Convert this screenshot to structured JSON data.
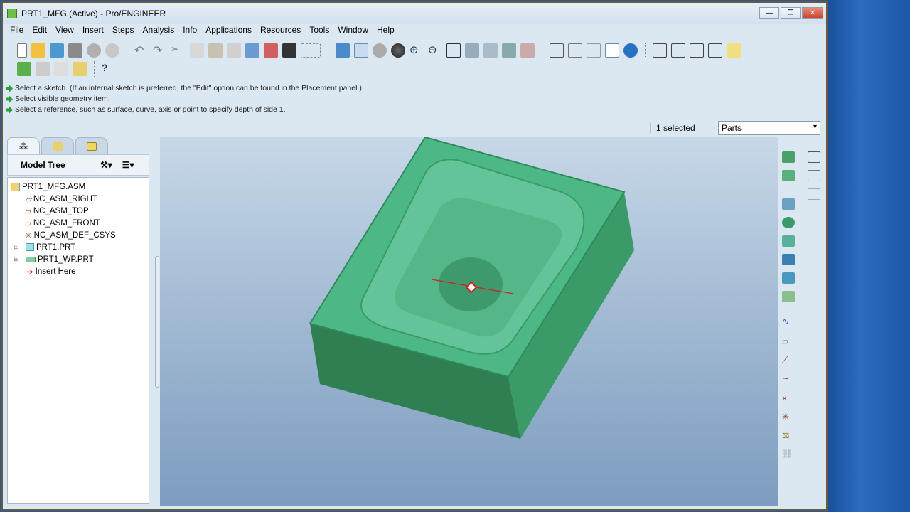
{
  "window": {
    "title": "PRT1_MFG (Active) - Pro/ENGINEER",
    "minimize": "—",
    "maximize": "❐",
    "close": "✕"
  },
  "menu": [
    "File",
    "Edit",
    "View",
    "Insert",
    "Steps",
    "Analysis",
    "Info",
    "Applications",
    "Resources",
    "Tools",
    "Window",
    "Help"
  ],
  "messages": [
    "Select a sketch. (If an internal sketch is preferred, the \"Edit\" option can be found in the Placement panel.)",
    "Select visible geometry item.",
    "Select a reference, such as surface, curve, axis or point to specify depth of side 1."
  ],
  "status": {
    "selected": "1 selected",
    "filter": "Parts"
  },
  "model_tree": {
    "title": "Model Tree",
    "items": [
      {
        "label": "PRT1_MFG.ASM",
        "icon": "assembly-icon"
      },
      {
        "label": "NC_ASM_RIGHT",
        "icon": "datum-plane-icon"
      },
      {
        "label": "NC_ASM_TOP",
        "icon": "datum-plane-icon"
      },
      {
        "label": "NC_ASM_FRONT",
        "icon": "datum-plane-icon"
      },
      {
        "label": "NC_ASM_DEF_CSYS",
        "icon": "csys-icon"
      },
      {
        "label": "PRT1.PRT",
        "icon": "part-icon"
      },
      {
        "label": "PRT1_WP.PRT",
        "icon": "workpiece-icon"
      },
      {
        "label": "Insert Here",
        "icon": "insert-arrow-icon"
      }
    ]
  },
  "colors": {
    "model": "#3aa87a",
    "background_top": "#c7d8e8",
    "background_bottom": "#7d9cc0"
  }
}
